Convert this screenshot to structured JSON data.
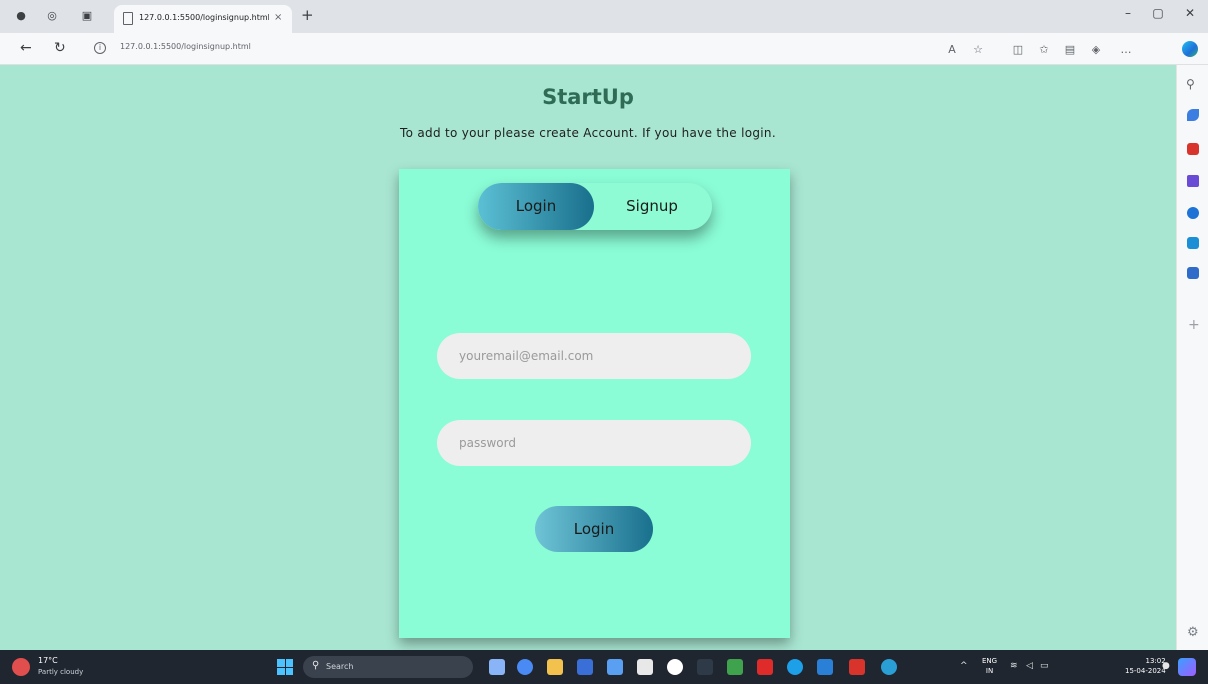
{
  "browser": {
    "tab_title": "127.0.0.1:5500/loginsignup.html",
    "tab_close": "×",
    "new_tab": "+",
    "url": "127.0.0.1:5500/loginsignup.html",
    "window_buttons": [
      "–",
      "▢",
      "✕"
    ]
  },
  "page": {
    "title": "StartUp",
    "subtitle": "To add to your please create Account. If you have the login."
  },
  "form": {
    "toggle_login": "Login",
    "toggle_signup": "Signup",
    "email_placeholder": "youremail@email.com",
    "password_placeholder": "password",
    "submit_label": "Login"
  },
  "taskbar": {
    "temperature": "17°C",
    "weather": "Partly cloudy",
    "search_label": "Search",
    "language": "ENG",
    "language_region": "IN",
    "time": "13:02",
    "date": "15-04-2024"
  },
  "colors": {
    "page_bg": "#a8e6d2",
    "card_bg": "#8afcd6",
    "title": "#2f6b55",
    "accent_gradient_start": "#5cc0d4",
    "accent_gradient_end": "#196f8c"
  }
}
